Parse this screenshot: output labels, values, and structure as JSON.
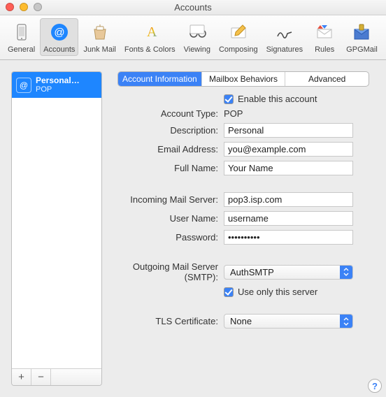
{
  "window": {
    "title": "Accounts"
  },
  "toolbar": {
    "items": [
      {
        "label": "General"
      },
      {
        "label": "Accounts"
      },
      {
        "label": "Junk Mail"
      },
      {
        "label": "Fonts & Colors"
      },
      {
        "label": "Viewing"
      },
      {
        "label": "Composing"
      },
      {
        "label": "Signatures"
      },
      {
        "label": "Rules"
      },
      {
        "label": "GPGMail"
      }
    ]
  },
  "sidebar": {
    "account": {
      "name": "Personal…",
      "sub": "POP"
    },
    "add": "+",
    "remove": "−"
  },
  "tabs": {
    "t0": "Account Information",
    "t1": "Mailbox Behaviors",
    "t2": "Advanced"
  },
  "labels": {
    "enable": "Enable this account",
    "account_type": "Account Type:",
    "description": "Description:",
    "email": "Email Address:",
    "fullname": "Full Name:",
    "incoming": "Incoming Mail Server:",
    "username": "User Name:",
    "password": "Password:",
    "smtp": "Outgoing Mail Server (SMTP):",
    "useonly": "Use only this server",
    "tls": "TLS Certificate:"
  },
  "values": {
    "account_type": "POP",
    "description": "Personal",
    "email": "you@example.com",
    "fullname": "Your Name",
    "incoming": "pop3.isp.com",
    "username": "username",
    "password": "••••••••••",
    "smtp": "AuthSMTP",
    "tls": "None"
  },
  "help": "?"
}
